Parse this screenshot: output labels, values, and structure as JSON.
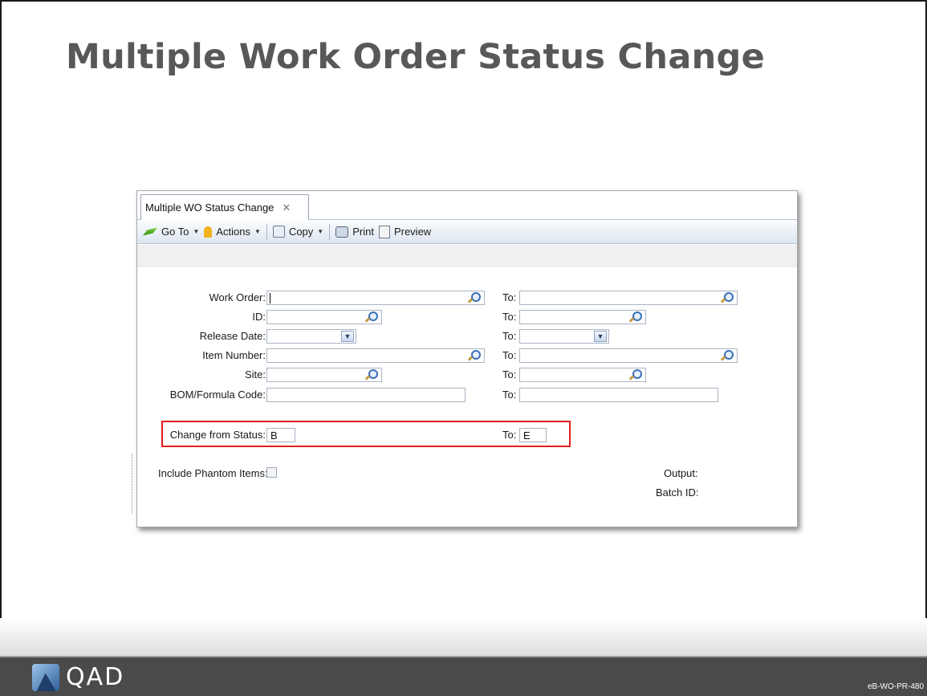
{
  "slide": {
    "title": "Multiple Work Order Status Change",
    "code": "eB-WO-PR-480",
    "logo_text": "QAD"
  },
  "window": {
    "tab_label": "Multiple WO Status Change",
    "toolbar": {
      "goto": "Go To",
      "actions": "Actions",
      "copy": "Copy",
      "print": "Print",
      "preview": "Preview"
    }
  },
  "form": {
    "work_order_label": "Work Order:",
    "id_label": "ID:",
    "release_date_label": "Release Date:",
    "item_number_label": "Item Number:",
    "site_label": "Site:",
    "bom_label": "BOM/Formula Code:",
    "to_label": "To:",
    "change_from_status_label": "Change from Status:",
    "change_from_status_value": "B",
    "change_to_status_value": "E",
    "include_phantom_label": "Include Phantom Items:",
    "output_label": "Output:",
    "batch_id_label": "Batch ID:"
  },
  "colors": {
    "title": "#585858",
    "highlight": "#e02020",
    "footer": "#4a4a4a"
  }
}
